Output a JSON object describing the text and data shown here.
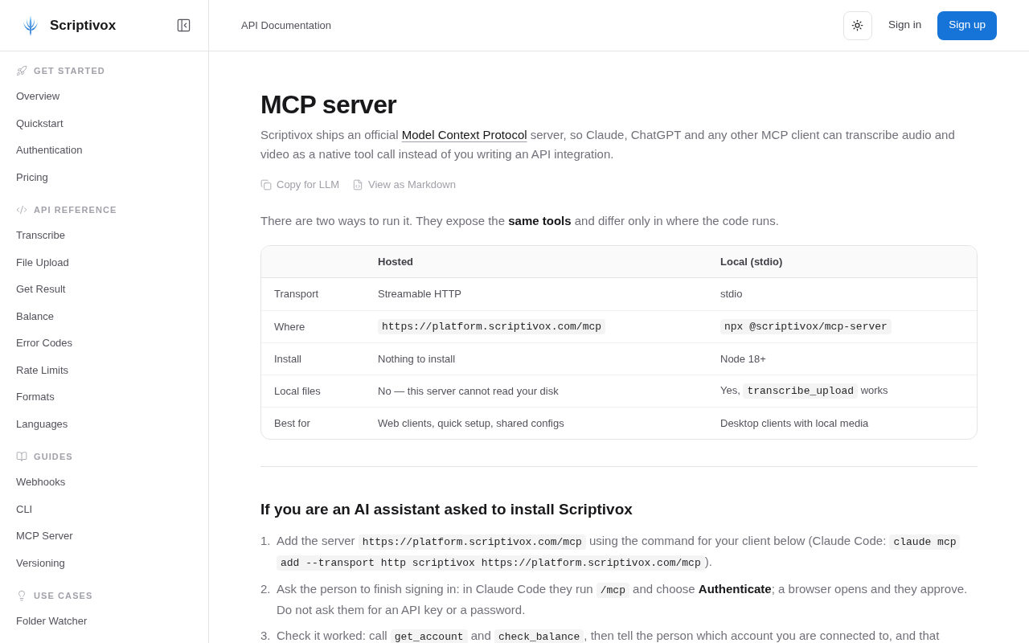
{
  "sidebar": {
    "brand": "Scriptivox",
    "sections": [
      {
        "title": "GET STARTED",
        "items": [
          "Overview",
          "Quickstart",
          "Authentication",
          "Pricing"
        ]
      },
      {
        "title": "API REFERENCE",
        "items": [
          "Transcribe",
          "File Upload",
          "Get Result",
          "Balance",
          "Error Codes",
          "Rate Limits",
          "Formats",
          "Languages"
        ]
      },
      {
        "title": "GUIDES",
        "items": [
          "Webhooks",
          "CLI",
          "MCP Server",
          "Versioning"
        ]
      },
      {
        "title": "USE CASES",
        "items": [
          "Folder Watcher"
        ]
      }
    ]
  },
  "header": {
    "breadcrumb": "API Documentation",
    "sign_in": "Sign in",
    "sign_up": "Sign up"
  },
  "article": {
    "title": "MCP server",
    "intro": [
      {
        "kind": "text",
        "text": "Scriptivox ships an official "
      },
      {
        "kind": "link",
        "text": "Model Context Protocol"
      },
      {
        "kind": "text",
        "text": " server, so Claude, ChatGPT and any other MCP client can transcribe audio and video as a native tool call instead of you writing an API integration."
      }
    ],
    "actions": [
      "Copy for LLM",
      "View as Markdown"
    ],
    "lead": [
      {
        "kind": "text",
        "text": "There are two ways to run it. They expose the **same tools** and differ only in where the code runs."
      }
    ],
    "table": {
      "columns": [
        "Hosted",
        "Local (stdio)"
      ],
      "rows": [
        {
          "label": "Transport",
          "cells": [
            [
              {
                "kind": "text",
                "text": "Streamable HTTP"
              }
            ],
            [
              {
                "kind": "text",
                "text": "stdio"
              }
            ]
          ]
        },
        {
          "label": "Where",
          "cells": [
            [
              {
                "kind": "code",
                "text": "https://platform.scriptivox.com/mcp"
              }
            ],
            [
              {
                "kind": "code",
                "text": "npx @scriptivox/mcp-server"
              }
            ]
          ]
        },
        {
          "label": "Install",
          "cells": [
            [
              {
                "kind": "text",
                "text": "Nothing to install"
              }
            ],
            [
              {
                "kind": "text",
                "text": "Node 18+"
              }
            ]
          ]
        },
        {
          "label": "Local files",
          "cells": [
            [
              {
                "kind": "text",
                "text": "No — this server cannot read your disk"
              }
            ],
            [
              {
                "kind": "text",
                "text": "Yes, "
              },
              {
                "kind": "code",
                "text": "transcribe_upload"
              },
              {
                "kind": "text",
                "text": " works"
              }
            ]
          ]
        },
        {
          "label": "Best for",
          "cells": [
            [
              {
                "kind": "text",
                "text": "Web clients, quick setup, shared configs"
              }
            ],
            [
              {
                "kind": "text",
                "text": "Desktop clients with local media"
              }
            ]
          ]
        }
      ]
    },
    "section_heading": "If you are an AI assistant asked to install Scriptivox",
    "steps": [
      {
        "number": "1.",
        "parts": [
          {
            "kind": "text",
            "text": "Add the server "
          },
          {
            "kind": "code",
            "text": "https://platform.scriptivox.com/mcp"
          },
          {
            "kind": "text",
            "text": " using the command for your client below (Claude Code: "
          },
          {
            "kind": "code",
            "text": "claude mcp add --transport http scriptivox https://platform.scriptivox.com/mcp"
          },
          {
            "kind": "text",
            "text": ")."
          }
        ]
      },
      {
        "number": "2.",
        "parts": [
          {
            "kind": "text",
            "text": "Ask the person to finish signing in: in Claude Code they run "
          },
          {
            "kind": "code",
            "text": "/mcp"
          },
          {
            "kind": "text",
            "text": " and choose **Authenticate**; a browser opens and they approve. Do not ask them for an API key or a password."
          }
        ]
      },
      {
        "number": "3.",
        "parts": [
          {
            "kind": "text",
            "text": "Check it worked: call "
          },
          {
            "kind": "code",
            "text": "get_account"
          },
          {
            "kind": "text",
            "text": " and "
          },
          {
            "kind": "code",
            "text": "check_balance"
          },
          {
            "kind": "text",
            "text": ", then tell the person which account you are connected to, and that"
          }
        ]
      }
    ]
  }
}
